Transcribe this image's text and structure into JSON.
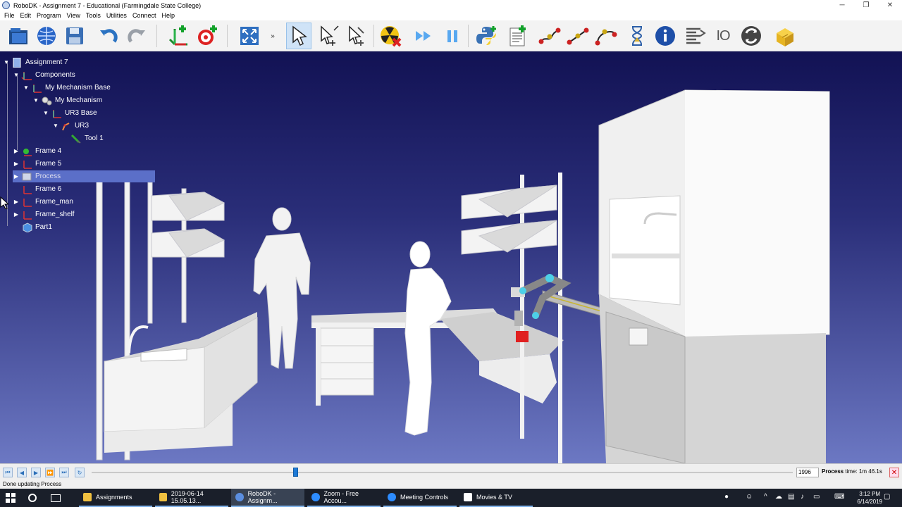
{
  "window": {
    "title": "RoboDK - Assignment 7 - Educational (Farmingdale State College)"
  },
  "menu": [
    "File",
    "Edit",
    "Program",
    "View",
    "Tools",
    "Utilities",
    "Connect",
    "Help"
  ],
  "toolbar": {
    "icons": [
      "open-station-icon",
      "online-library-icon",
      "save-icon",
      "undo-icon",
      "redo-icon",
      "add-reference-frame-icon",
      "add-target-icon",
      "fit-all-icon",
      "more-icon",
      "select-icon",
      "move-reference-icon",
      "move-tool-icon",
      "collision-check-icon",
      "fast-simulation-icon",
      "pause-icon",
      "python-program-icon",
      "new-program-icon",
      "joint-move-icon",
      "linear-move-icon",
      "circular-move-icon",
      "pause-instruction-icon",
      "message-icon",
      "program-call-icon",
      "io-icon",
      "set-reference-icon",
      "add-tool-icon"
    ]
  },
  "tree": {
    "nodes": [
      {
        "label": "Assignment 7",
        "icon": "station-icon",
        "expanded": true
      },
      {
        "label": "Components",
        "icon": "frame-icon",
        "expanded": true
      },
      {
        "label": "My Mechanism Base",
        "icon": "frame-icon",
        "expanded": true
      },
      {
        "label": "My Mechanism",
        "icon": "mechanism-icon",
        "expanded": true
      },
      {
        "label": "UR3 Base",
        "icon": "frame-icon",
        "expanded": true
      },
      {
        "label": "UR3",
        "icon": "robot-icon",
        "expanded": true
      },
      {
        "label": "Tool 1",
        "icon": "tool-icon"
      },
      {
        "label": "Frame 4",
        "icon": "frame-icon",
        "expanded": false
      },
      {
        "label": "Frame 5",
        "icon": "frame-icon",
        "expanded": false
      },
      {
        "label": "Process",
        "icon": "program-icon",
        "expanded": false,
        "selected": true
      },
      {
        "label": "Frame 6",
        "icon": "frame-icon"
      },
      {
        "label": "Frame_man",
        "icon": "frame-icon",
        "expanded": false
      },
      {
        "label": "Frame_shelf",
        "icon": "frame-icon",
        "expanded": false
      },
      {
        "label": "Part1",
        "icon": "part-icon"
      }
    ]
  },
  "timeline": {
    "value": "1996",
    "process_time_label": "Process",
    "process_time_value": "time: 1m 46.1s",
    "progress": 0.29
  },
  "status": {
    "text": "Done updating Process"
  },
  "taskbar": {
    "items": [
      "Assignments",
      "2019-06-14 15.05.13...",
      "RoboDK - Assignm...",
      "Zoom - Free Accou...",
      "Meeting Controls",
      "Movies & TV"
    ],
    "time": "3:12 PM",
    "date": "6/14/2019"
  },
  "colors": {
    "viewport_top": "#121254",
    "viewport_bottom": "#6c78c3",
    "selection": "#5b6fc8",
    "red_part": "#e02020"
  }
}
